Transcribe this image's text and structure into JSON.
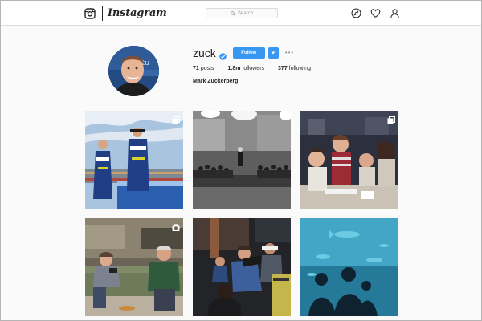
{
  "header": {
    "brand": "Instagram",
    "search_placeholder": "Search",
    "icons": [
      "instagram-glyph-icon",
      "search-icon",
      "compass-icon",
      "heart-icon",
      "user-icon"
    ]
  },
  "profile": {
    "username": "zuck",
    "follow_label": "Follow",
    "more_label": "•••",
    "stats": {
      "posts_value": "71",
      "posts_label": "posts",
      "followers_value": "1.8m",
      "followers_label": "followers",
      "following_value": "377",
      "following_label": "following"
    },
    "full_name": "Mark Zuckerberg"
  },
  "posts": [
    {
      "id": 1,
      "scene": "race-drivers-in-blue-suits",
      "badge": "multiple-photos-icon"
    },
    {
      "id": 2,
      "scene": "black-and-white-townhall",
      "badge": ""
    },
    {
      "id": 3,
      "scene": "childhood-family-photo",
      "badge": "multiple-photos-icon"
    },
    {
      "id": 4,
      "scene": "office-couch-conversation",
      "badge": "video-icon"
    },
    {
      "id": 5,
      "scene": "people-with-vr-headsets",
      "badge": ""
    },
    {
      "id": 6,
      "scene": "aquarium-silhouettes",
      "badge": ""
    }
  ],
  "colors": {
    "accent": "#3897f0",
    "text": "#262626",
    "muted": "#999999",
    "border": "#dbdbdb",
    "background": "#fafafa"
  }
}
